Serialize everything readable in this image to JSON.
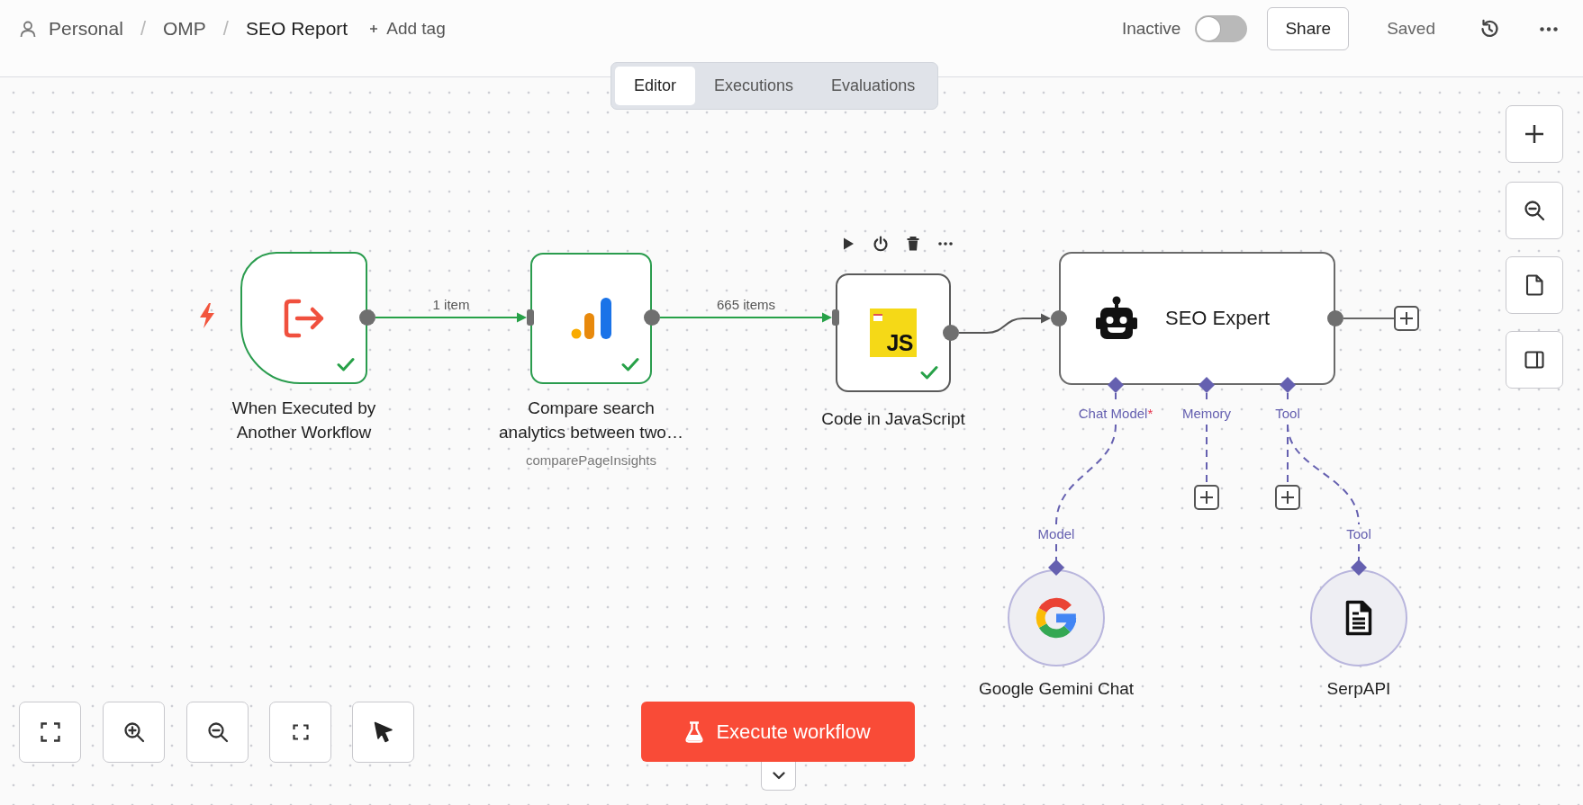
{
  "breadcrumb": {
    "items": [
      "Personal",
      "OMP",
      "SEO Report"
    ],
    "separators": [
      "/",
      "/"
    ]
  },
  "add_tag": "Add tag",
  "activation": {
    "label": "Inactive",
    "on": false
  },
  "share_button": "Share",
  "save_status": "Saved",
  "tabs": [
    {
      "label": "Editor",
      "selected": true
    },
    {
      "label": "Executions",
      "selected": false
    },
    {
      "label": "Evaluations",
      "selected": false
    }
  ],
  "nodes": [
    {
      "kind": "trigger",
      "title": "When Executed by Another Workflow",
      "executed": true,
      "hovered": false,
      "output_add_button": false
    },
    {
      "kind": "analytics",
      "title": "Compare search analytics between two…",
      "subtitle": "comparePageInsights",
      "executed": true,
      "hovered": false,
      "output_add_button": false
    },
    {
      "kind": "code",
      "title": "Code in JavaScript",
      "logo_text": "JS",
      "executed": true,
      "hovered": true,
      "output_add_button": false
    },
    {
      "kind": "agent",
      "title": "SEO Expert",
      "executed": false,
      "hovered": false,
      "output_add_button": true,
      "inputs": [
        {
          "label": "Chat Model",
          "required_mark": "*",
          "add_button": false,
          "sub_nodes": [
            {
              "kind": "model",
              "title": "Google Gemini Chat",
              "port_label": "Model"
            }
          ]
        },
        {
          "label": "Memory",
          "add_button": true
        },
        {
          "label": "Tool",
          "add_button": true,
          "sub_nodes": [
            {
              "kind": "tool",
              "title": "SerpAPI",
              "port_label": "Tool"
            }
          ]
        }
      ]
    }
  ],
  "connections": [
    {
      "label": "1 item",
      "executed": true
    },
    {
      "label": "665 items",
      "executed": true
    },
    {
      "executed": false
    }
  ],
  "execute_button": "Execute workflow"
}
